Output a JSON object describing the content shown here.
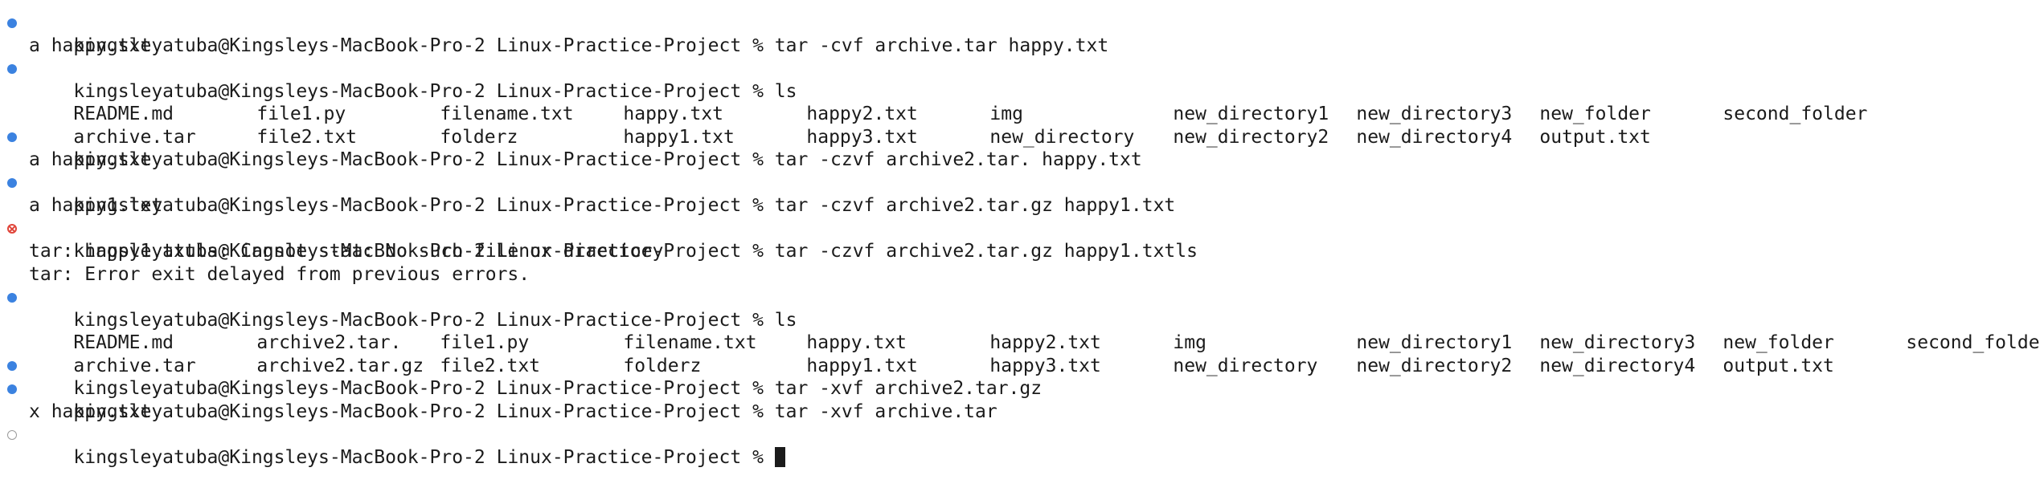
{
  "prompt": "kingsleyatuba@Kingsleys-MacBook-Pro-2 Linux-Practice-Project % ",
  "commands": {
    "c1": "tar -cvf archive.tar happy.txt",
    "c2": "ls",
    "c3": "tar -czvf archive2.tar. happy.txt",
    "c4": "tar -czvf archive2.tar.gz happy1.txt",
    "c5": "tar -czvf archive2.tar.gz happy1.txtls",
    "c6": "ls",
    "c7": "tar -xvf archive2.tar.gz",
    "c8": "tar -xvf archive.tar"
  },
  "outputs": {
    "o1": "a happy.txt",
    "o3": "a happy.txt",
    "o4": "a happy1.txt",
    "o5a": "tar: happy1.txtls: Cannot stat: No such file or directory",
    "o5b": "tar: Error exit delayed from previous errors.",
    "o8": "x happy.txt"
  },
  "ls1": {
    "row1": [
      "README.md",
      "file1.py",
      "filename.txt",
      "happy.txt",
      "happy2.txt",
      "img",
      "new_directory1",
      "new_directory3",
      "new_folder",
      "second_folder"
    ],
    "row2": [
      "archive.tar",
      "file2.txt",
      "folderz",
      "happy1.txt",
      "happy3.txt",
      "new_directory",
      "new_directory2",
      "new_directory4",
      "output.txt"
    ]
  },
  "ls2": {
    "row1": [
      "README.md",
      "archive2.tar.",
      "file1.py",
      "filename.txt",
      "happy.txt",
      "happy2.txt",
      "img",
      "new_directory1",
      "new_directory3",
      "new_folder",
      "second_folder"
    ],
    "row2": [
      "archive.tar",
      "archive2.tar.gz",
      "file2.txt",
      "folderz",
      "happy1.txt",
      "happy3.txt",
      "new_directory",
      "new_directory2",
      "new_directory4",
      "output.txt"
    ]
  },
  "colors": {
    "success_marker": "#3b82e0",
    "error_marker": "#e0453a",
    "pending_marker": "#9b9b9b",
    "text": "#1b1b1b",
    "background": "#ffffff"
  }
}
